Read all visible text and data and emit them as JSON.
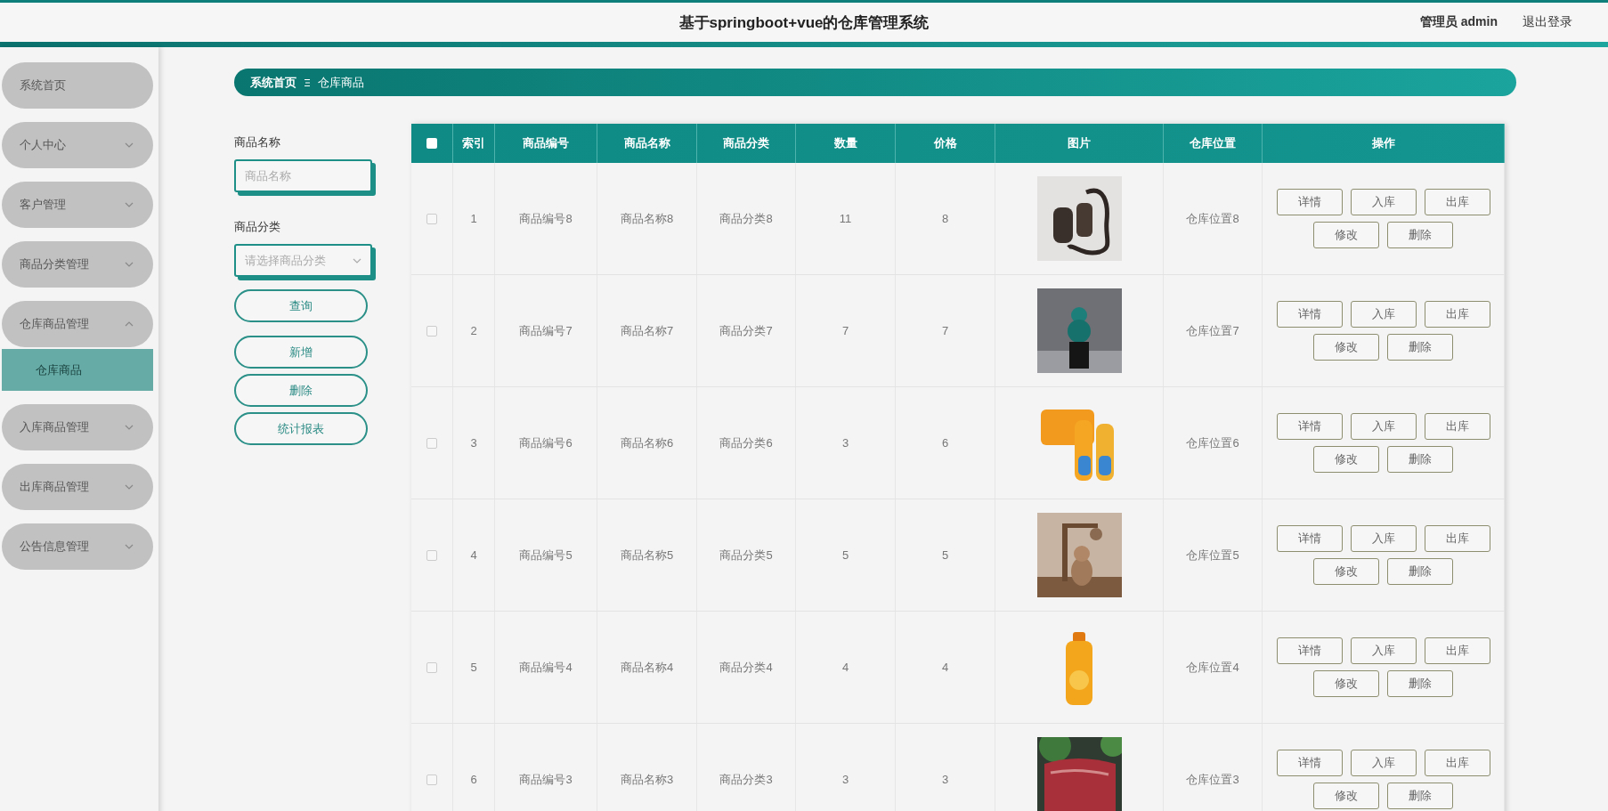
{
  "header": {
    "title": "基于springboot+vue的仓库管理系统",
    "user": "管理员 admin",
    "logout": "退出登录"
  },
  "sidebar": {
    "items": [
      {
        "label": "系统首页",
        "kind": "link"
      },
      {
        "label": "个人中心",
        "kind": "menu",
        "expanded": false
      },
      {
        "label": "客户管理",
        "kind": "menu",
        "expanded": false
      },
      {
        "label": "商品分类管理",
        "kind": "menu",
        "expanded": false
      },
      {
        "label": "仓库商品管理",
        "kind": "menu",
        "expanded": true,
        "children": [
          {
            "label": "仓库商品",
            "selected": true
          }
        ]
      },
      {
        "label": "入库商品管理",
        "kind": "menu",
        "expanded": false
      },
      {
        "label": "出库商品管理",
        "kind": "menu",
        "expanded": false
      },
      {
        "label": "公告信息管理",
        "kind": "menu",
        "expanded": false
      }
    ]
  },
  "breadcrumb": [
    "系统首页",
    "仓库商品"
  ],
  "filters": {
    "fields": [
      {
        "label": "商品名称",
        "kind": "input",
        "placeholder": "商品名称"
      },
      {
        "label": "商品分类",
        "kind": "select",
        "placeholder": "请选择商品分类"
      }
    ],
    "buttons": [
      "查询",
      "新增",
      "删除",
      "统计报表"
    ]
  },
  "table": {
    "all_checked": false,
    "columns": [
      "索引",
      "商品编号",
      "商品名称",
      "商品分类",
      "数量",
      "价格",
      "图片",
      "仓库位置",
      "操作"
    ],
    "rows": [
      {
        "checked": false,
        "cells": [
          "1",
          "商品编号8",
          "商品名称8",
          "商品分类8",
          "11",
          "8"
        ],
        "location": "仓库位置8",
        "actions": [
          "详情",
          "入库",
          "出库",
          "修改",
          "删除"
        ]
      },
      {
        "checked": false,
        "cells": [
          "2",
          "商品编号7",
          "商品名称7",
          "商品分类7",
          "7",
          "7"
        ],
        "location": "仓库位置7",
        "actions": [
          "详情",
          "入库",
          "出库",
          "修改",
          "删除"
        ]
      },
      {
        "checked": false,
        "cells": [
          "3",
          "商品编号6",
          "商品名称6",
          "商品分类6",
          "3",
          "6"
        ],
        "location": "仓库位置6",
        "actions": [
          "详情",
          "入库",
          "出库",
          "修改",
          "删除"
        ]
      },
      {
        "checked": false,
        "cells": [
          "4",
          "商品编号5",
          "商品名称5",
          "商品分类5",
          "5",
          "5"
        ],
        "location": "仓库位置5",
        "actions": [
          "详情",
          "入库",
          "出库",
          "修改",
          "删除"
        ]
      },
      {
        "checked": false,
        "cells": [
          "5",
          "商品编号4",
          "商品名称4",
          "商品分类4",
          "4",
          "4"
        ],
        "location": "仓库位置4",
        "actions": [
          "详情",
          "入库",
          "出库",
          "修改",
          "删除"
        ]
      },
      {
        "checked": false,
        "cells": [
          "6",
          "商品编号3",
          "商品名称3",
          "商品分类3",
          "3",
          "3"
        ],
        "location": "仓库位置3",
        "actions": [
          "详情",
          "入库",
          "出库",
          "修改",
          "删除"
        ]
      }
    ]
  }
}
